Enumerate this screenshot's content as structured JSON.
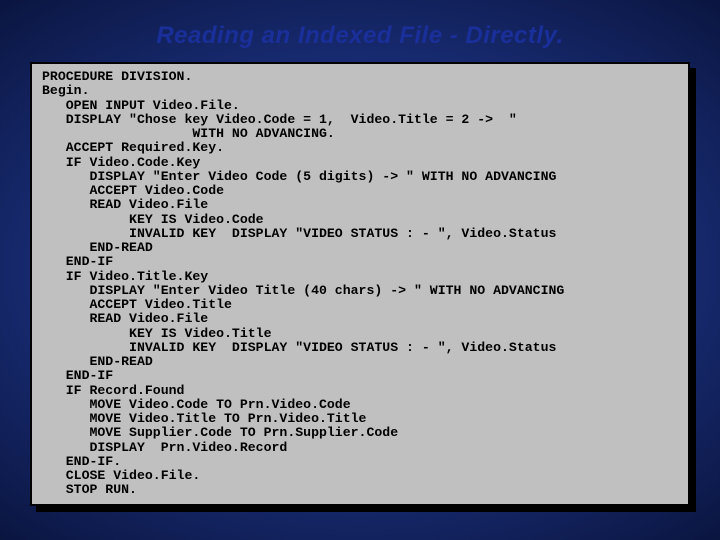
{
  "slide": {
    "title": "Reading an Indexed File - Directly."
  },
  "code": {
    "lines": [
      "PROCEDURE DIVISION.",
      "Begin.",
      "   OPEN INPUT Video.File.",
      "   DISPLAY \"Chose key Video.Code = 1,  Video.Title = 2 ->  \"",
      "                   WITH NO ADVANCING.",
      "   ACCEPT Required.Key.",
      "   IF Video.Code.Key",
      "      DISPLAY \"Enter Video Code (5 digits) -> \" WITH NO ADVANCING",
      "      ACCEPT Video.Code",
      "      READ Video.File",
      "           KEY IS Video.Code",
      "           INVALID KEY  DISPLAY \"VIDEO STATUS : - \", Video.Status",
      "      END-READ",
      "   END-IF",
      "   IF Video.Title.Key",
      "      DISPLAY \"Enter Video Title (40 chars) -> \" WITH NO ADVANCING",
      "      ACCEPT Video.Title",
      "      READ Video.File",
      "           KEY IS Video.Title",
      "           INVALID KEY  DISPLAY \"VIDEO STATUS : - \", Video.Status",
      "      END-READ",
      "   END-IF",
      "   IF Record.Found",
      "      MOVE Video.Code TO Prn.Video.Code",
      "      MOVE Video.Title TO Prn.Video.Title",
      "      MOVE Supplier.Code TO Prn.Supplier.Code",
      "      DISPLAY  Prn.Video.Record",
      "   END-IF.",
      "   CLOSE Video.File.",
      "   STOP RUN."
    ]
  }
}
